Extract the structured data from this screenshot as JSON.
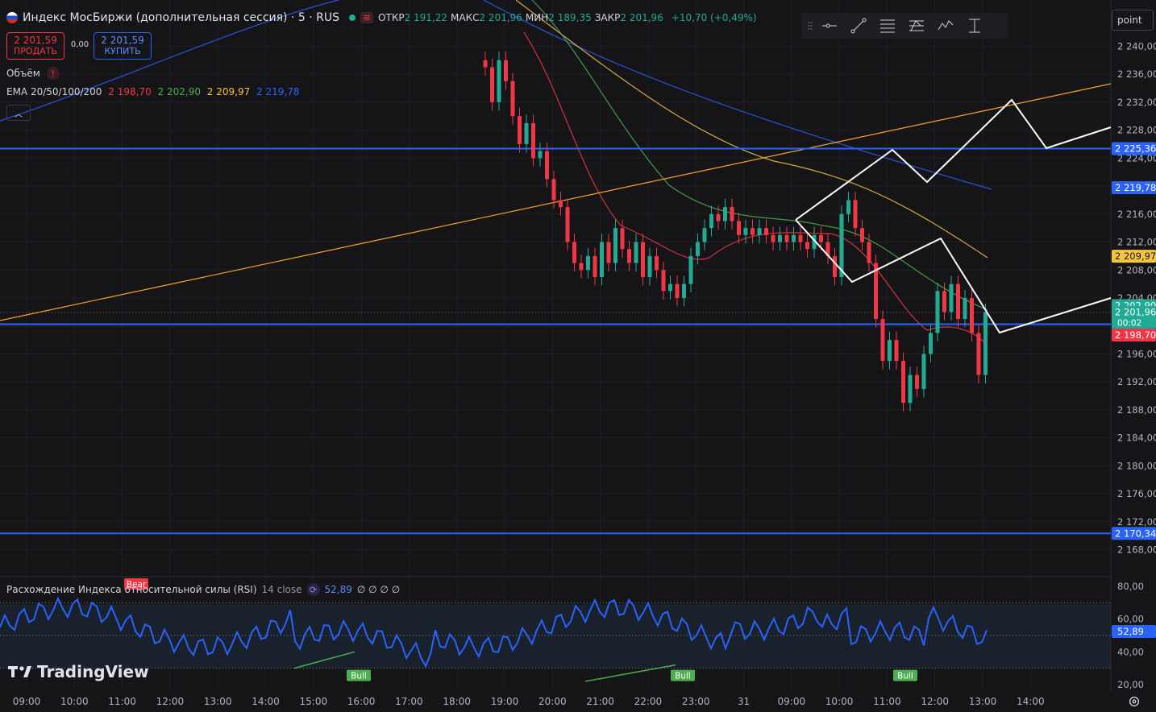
{
  "header": {
    "title": "Индекс МосБиржи (дополнительная сессия) · 5 · RUS",
    "ohlc": [
      {
        "label": "ОТКР",
        "value": "2 191,22"
      },
      {
        "label": "МАКС",
        "value": "2 201,96"
      },
      {
        "label": "МИН",
        "value": "2 189,35"
      },
      {
        "label": "ЗАКР",
        "value": "2 201,96"
      }
    ],
    "change": "+10,70 (+0,49%)",
    "sell_price": "2 201,59",
    "sell_label": "ПРОДАТЬ",
    "buy_price": "2 201,59",
    "buy_label": "КУПИТЬ",
    "spread": "0,00"
  },
  "indicators": {
    "volume_label": "Объём",
    "ema_label": "EMA 20/50/100/200",
    "ema_values": [
      "2 198,70",
      "2 202,90",
      "2 209,97",
      "2 219,78"
    ],
    "ema_colors": [
      "#f23645",
      "#4caf50",
      "#f5c542",
      "#2962ff"
    ]
  },
  "toolbar": {
    "items": [
      "horizontal-ray-icon",
      "trend-line-icon",
      "fib-retracement-icon",
      "fib-extension-icon",
      "pattern-icon",
      "long-position-icon"
    ],
    "point_label": "point"
  },
  "rsi": {
    "label": "Расхождение Индекса относительной силы (RSI)",
    "params": "14 close",
    "value": "52,89",
    "flags": "∅ ∅ ∅ ∅",
    "axis": [
      "80,00",
      "60,00",
      "40,00",
      "20,00"
    ],
    "labels": [
      {
        "text": "Bear",
        "idx": 28,
        "color": "#f23645"
      },
      {
        "text": "Bull",
        "idx": 74,
        "color": "#4caf50"
      },
      {
        "text": "Bull",
        "idx": 141,
        "color": "#4caf50"
      },
      {
        "text": "Bull",
        "idx": 187,
        "color": "#4caf50"
      }
    ]
  },
  "chart_data": {
    "type": "candlestick",
    "price_range": [
      2166,
      2242
    ],
    "price_ticks": [
      "2 240,00",
      "2 236,00",
      "2 232,00",
      "2 228,00",
      "2 224,00",
      "2 220,00",
      "2 216,00",
      "2 212,00",
      "2 208,00",
      "2 204,00",
      "2 200,00",
      "2 196,00",
      "2 192,00",
      "2 188,00",
      "2 184,00",
      "2 180,00",
      "2 176,00",
      "2 172,00",
      "2 168,00"
    ],
    "time_labels": [
      "09:00",
      "10:00",
      "11:00",
      "12:00",
      "13:00",
      "14:00",
      "15:00",
      "16:00",
      "17:00",
      "18:00",
      "19:00",
      "20:00",
      "21:00",
      "22:00",
      "23:00",
      "31",
      "09:00",
      "10:00",
      "11:00",
      "12:00",
      "13:00",
      "14:00"
    ],
    "horizontal_levels": [
      {
        "price": 2225.36,
        "label": "2 225,36",
        "color": "#2962ff"
      },
      {
        "price": 2200.26,
        "label": "2 200,26",
        "color": "#2962ff"
      },
      {
        "price": 2170.34,
        "label": "2 170,34",
        "color": "#2962ff"
      }
    ],
    "price_badges": [
      {
        "price": 2219.78,
        "label": "2 219,78",
        "color": "#2962ff"
      },
      {
        "price": 2209.97,
        "label": "2 209,97",
        "color": "#f5c542"
      },
      {
        "price": 2202.9,
        "label": "2 202,90",
        "color": "#22ab94"
      },
      {
        "price": 2201.96,
        "label": "2 201,96",
        "sub": "00:02",
        "color": "#22ab94"
      },
      {
        "price": 2198.7,
        "label": "2 198,70",
        "color": "#f23645"
      }
    ],
    "closes": [
      2237,
      2232,
      2238,
      2235,
      2230,
      2226,
      2229,
      2224,
      2225,
      2221,
      2218,
      2217,
      2212,
      2209,
      2208,
      2210,
      2207,
      2212,
      2209,
      2214,
      2211,
      2209,
      2212,
      2207,
      2210,
      2208,
      2205,
      2206,
      2204,
      2206,
      2210,
      2212,
      2214,
      2216,
      2215,
      2217,
      2215,
      2213,
      2214,
      2213,
      2214,
      2213,
      2212,
      2213,
      2212,
      2213,
      2212,
      2211,
      2213,
      2212,
      2210,
      2207,
      2216,
      2218,
      2214,
      2212,
      2209,
      2201,
      2195,
      2198,
      2195,
      2189,
      2193,
      2191,
      2196,
      2199,
      2205,
      2202,
      2206,
      2201,
      2204,
      2199,
      2193,
      2202
    ]
  }
}
